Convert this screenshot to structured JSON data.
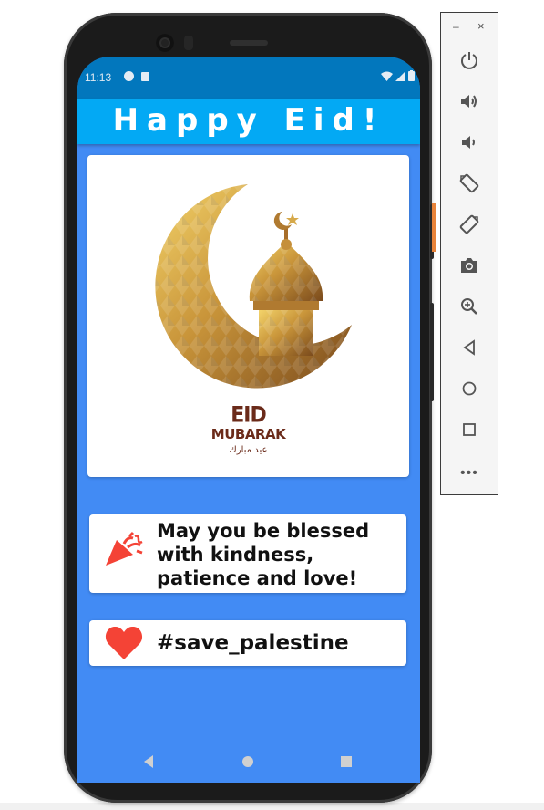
{
  "status_bar": {
    "time": "11:13"
  },
  "app_bar": {
    "title": "Happy Eid!"
  },
  "image_card": {
    "line1": "EID",
    "line2": "MUBARAK",
    "arabic": "عيد مبارك"
  },
  "cards": [
    {
      "icon": "party-popper-icon",
      "text": "May you be blessed with kindness, patience and love!"
    },
    {
      "icon": "heart-icon",
      "text": "#save_palestine"
    }
  ],
  "toolbar": {
    "minimize": "–",
    "close": "×",
    "more": "•••",
    "buttons": [
      "power-icon",
      "volume-up-icon",
      "volume-down-icon",
      "rotate-left-icon",
      "rotate-right-icon",
      "camera-icon",
      "zoom-icon",
      "back-icon",
      "home-icon",
      "overview-icon"
    ]
  },
  "colors": {
    "status_bar": "#0277bd",
    "app_bar": "#03a9f4",
    "background": "#428bf4",
    "heart": "#f44336"
  }
}
